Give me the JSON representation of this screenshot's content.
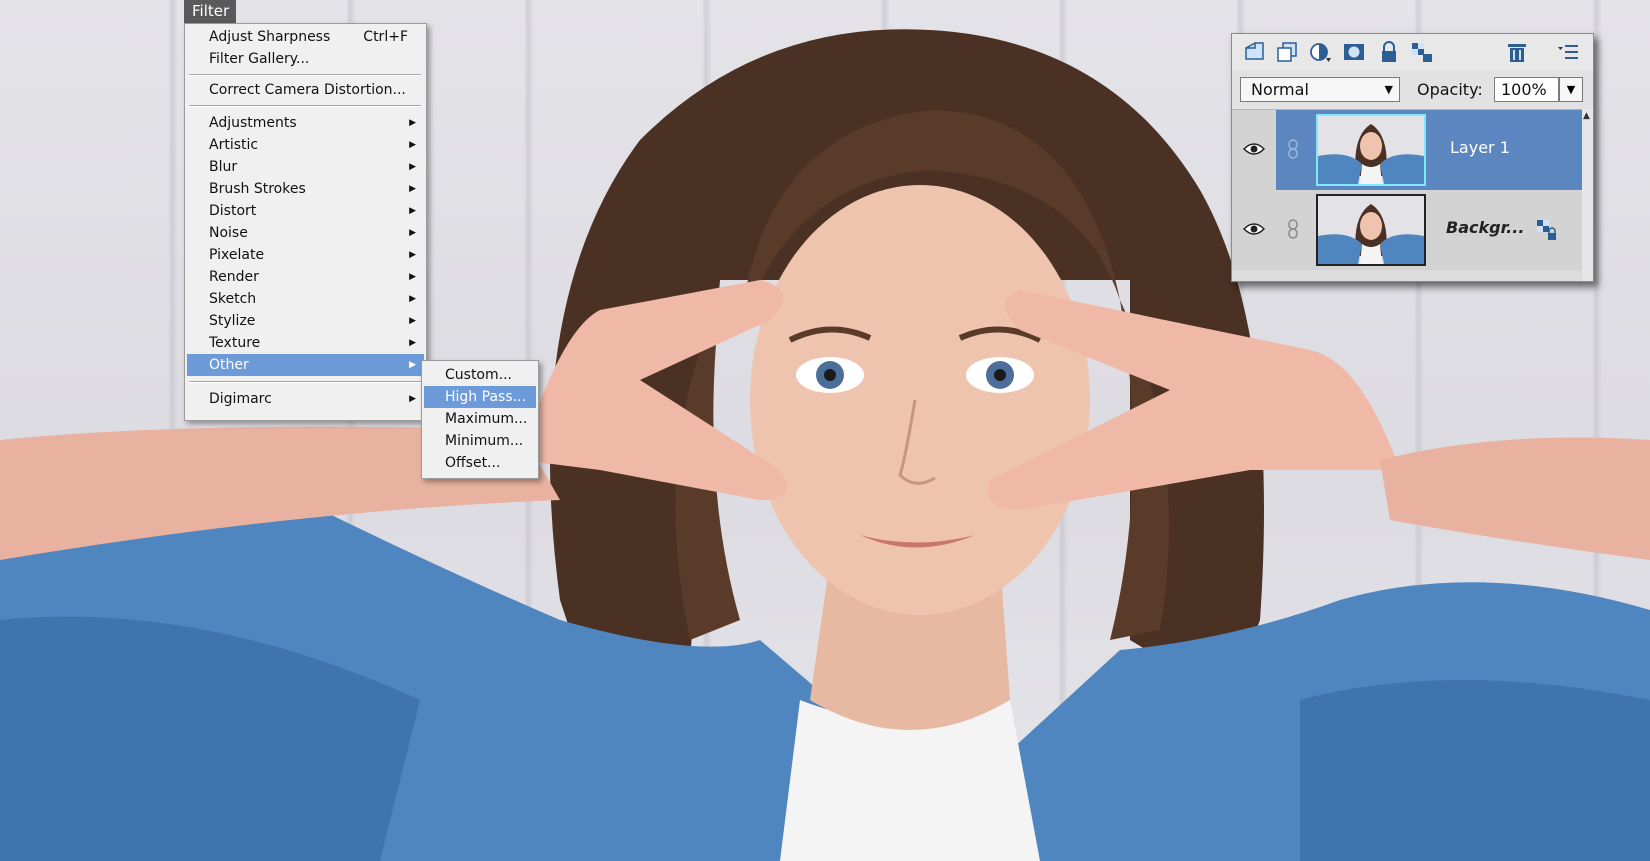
{
  "menu": {
    "title": "Filter",
    "top_items": [
      {
        "label": "Adjust Sharpness",
        "shortcut": "Ctrl+F"
      },
      {
        "label": "Filter Gallery..."
      }
    ],
    "camera_item": {
      "label": "Correct Camera Distortion..."
    },
    "category_items": [
      {
        "label": "Adjustments"
      },
      {
        "label": "Artistic"
      },
      {
        "label": "Blur"
      },
      {
        "label": "Brush Strokes"
      },
      {
        "label": "Distort"
      },
      {
        "label": "Noise"
      },
      {
        "label": "Pixelate"
      },
      {
        "label": "Render"
      },
      {
        "label": "Sketch"
      },
      {
        "label": "Stylize"
      },
      {
        "label": "Texture"
      },
      {
        "label": "Other"
      }
    ],
    "selected_category": "Other",
    "digimarc_item": {
      "label": "Digimarc"
    },
    "submenu_items": [
      {
        "label": "Custom..."
      },
      {
        "label": "High Pass..."
      },
      {
        "label": "Maximum..."
      },
      {
        "label": "Minimum..."
      },
      {
        "label": "Offset..."
      }
    ],
    "selected_submenu": "High Pass...",
    "highlight_color": "#6d9bd9"
  },
  "layers_panel": {
    "toolbar_icons": [
      "new-layer-icon",
      "duplicate-layer-icon",
      "adjustment-layer-icon",
      "layer-mask-icon",
      "lock-icon",
      "lock-transparency-icon",
      "trash-icon",
      "panel-menu-icon"
    ],
    "blend_mode": "Normal",
    "opacity_label": "Opacity:",
    "opacity_value": "100%",
    "layers": [
      {
        "name": "Layer 1",
        "selected": true,
        "visible": true
      },
      {
        "name": "Backgr...",
        "selected": false,
        "visible": true,
        "locked": true
      }
    ],
    "selected_row_color": "#5b86c0"
  }
}
